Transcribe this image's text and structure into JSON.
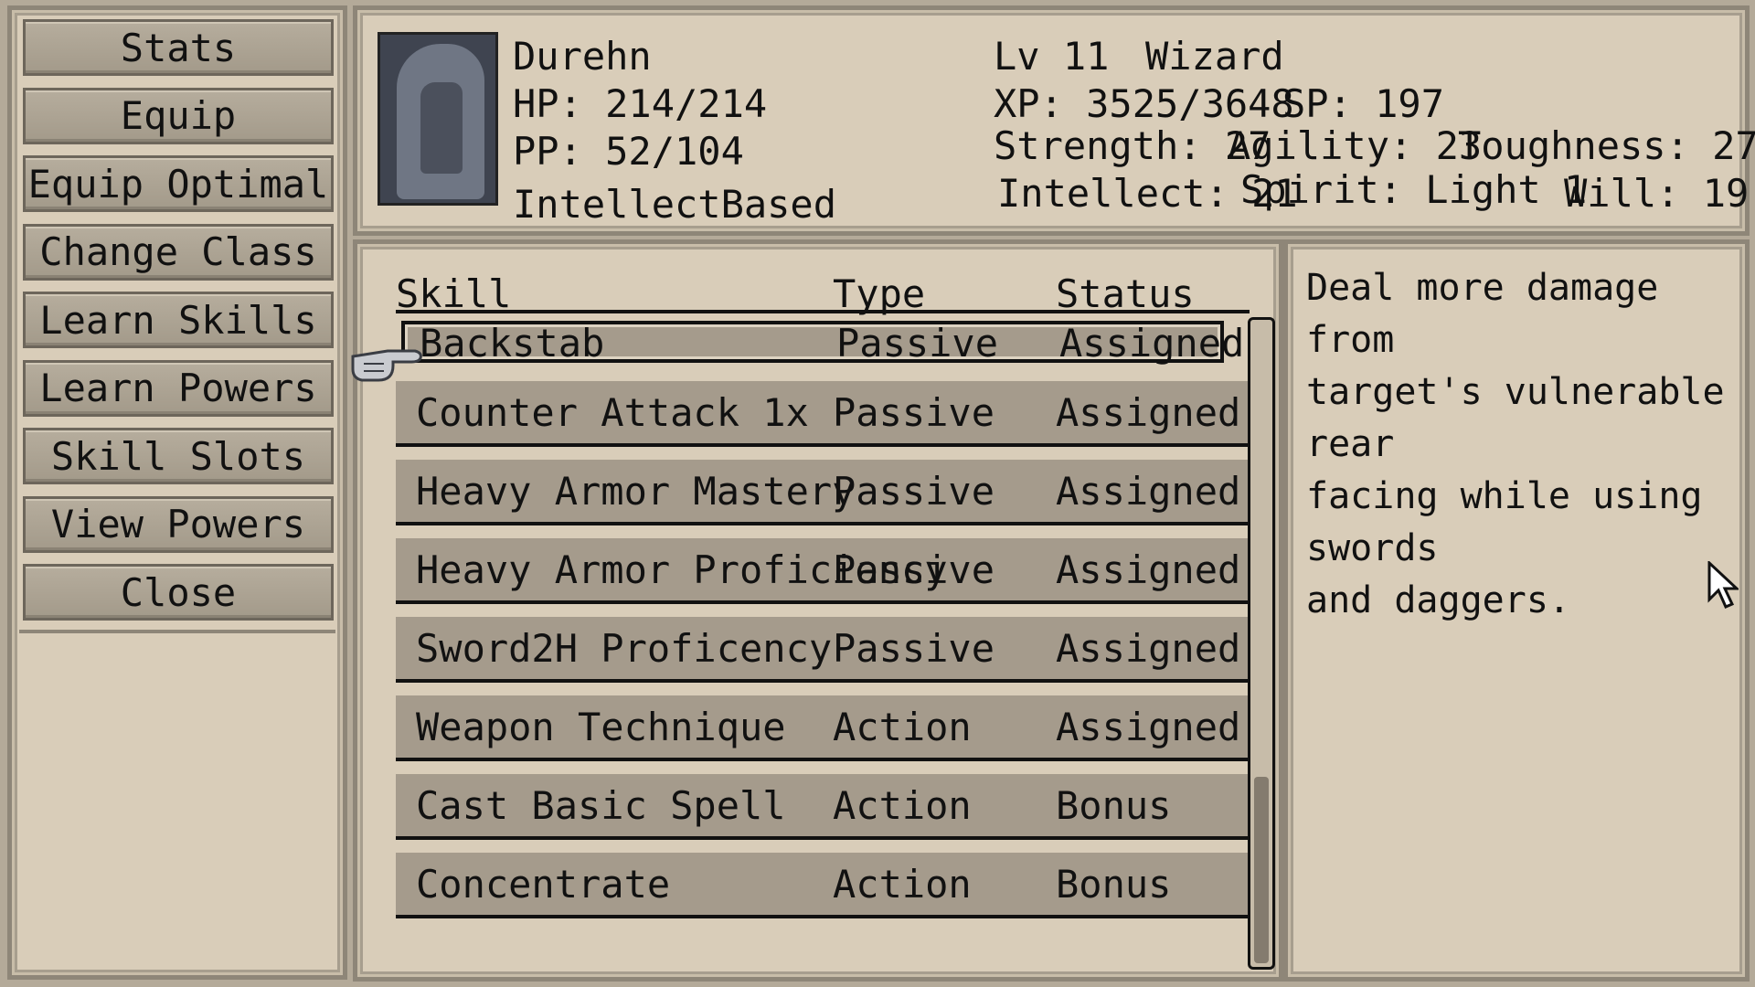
{
  "menu": {
    "items": [
      {
        "label": "Stats",
        "name": "menu-stats-button"
      },
      {
        "label": "Equip",
        "name": "menu-equip-button"
      },
      {
        "label": "Equip Optimal",
        "name": "menu-equip-optimal-button"
      },
      {
        "label": "Change Class",
        "name": "menu-change-class-button"
      },
      {
        "label": "Learn Skills",
        "name": "menu-learn-skills-button"
      },
      {
        "label": "Learn Powers",
        "name": "menu-learn-powers-button"
      },
      {
        "label": "Skill Slots",
        "name": "menu-skill-slots-button"
      },
      {
        "label": "View Powers",
        "name": "menu-view-powers-button"
      },
      {
        "label": "Close",
        "name": "menu-close-button"
      }
    ]
  },
  "character": {
    "name": "Durehn",
    "hp": "HP: 214/214",
    "pp": "PP: 52/104",
    "build": "IntellectBased",
    "level": "Lv 11",
    "class": "Wizard",
    "xp": "XP: 3525/3648",
    "sp": "SP: 197",
    "strength": "Strength: 27",
    "agility": "Agility: 23",
    "toughness": "Toughness: 27",
    "intellect": "Intellect: 21",
    "spirit": "Spirit: Light 1",
    "will": "Will: 19",
    "portrait_icon": "hooded-figure-portrait"
  },
  "skills_table": {
    "headers": {
      "skill": "Skill",
      "type": "Type",
      "status": "Status"
    },
    "rows": [
      {
        "skill": "Backstab",
        "type": "Passive",
        "status": "Assigned"
      },
      {
        "skill": "Counter Attack 1x",
        "type": "Passive",
        "status": "Assigned"
      },
      {
        "skill": "Heavy Armor Mastery",
        "type": "Passive",
        "status": "Assigned"
      },
      {
        "skill": "Heavy Armor Proficiency",
        "type": "Passive",
        "status": "Assigned"
      },
      {
        "skill": "Sword2H Proficency",
        "type": "Passive",
        "status": "Assigned"
      },
      {
        "skill": "Weapon Technique",
        "type": "Action",
        "status": "Assigned"
      },
      {
        "skill": "Cast Basic Spell",
        "type": "Action",
        "status": "Bonus"
      },
      {
        "skill": "Concentrate",
        "type": "Action",
        "status": "Bonus"
      }
    ],
    "selected_index": 0
  },
  "description": "Deal more damage from\ntarget's vulnerable rear\nfacing while using swords\nand daggers.",
  "icons": {
    "selector": "pointing-hand-icon",
    "mouse": "mouse-arrow-icon"
  }
}
